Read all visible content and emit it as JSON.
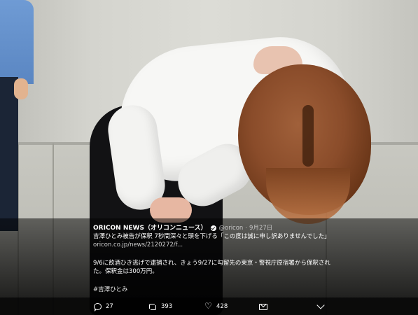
{
  "tweet": {
    "display_name": "ORICON NEWS（オリコンニュース）",
    "handle": "@oricon",
    "separator": "·",
    "timestamp": "9月27日",
    "line1": "吉澤ひとみ被告が保釈 7秒間深々と頭を下げる「この度は誠に申し訳ありませんでした」",
    "link": "oricon.co.jp/news/2120272/f...",
    "line2": "9/6に飲酒ひき逃げで逮捕され、きょう9/27に勾留先の東京・警視庁原宿署から保釈され",
    "line3": "た。保釈金は300万円。",
    "hashtag": "#吉澤ひとみ"
  },
  "actions": {
    "reply_count": "27",
    "retweet_count": "393",
    "like_count": "428"
  },
  "colors": {
    "overlay": "#000000",
    "text": "#ffffff",
    "meta_text": "#c7c7c7"
  },
  "icons": [
    "verified-icon",
    "reply-icon",
    "retweet-icon",
    "like-icon",
    "mail-icon",
    "chevron-down-icon"
  ]
}
